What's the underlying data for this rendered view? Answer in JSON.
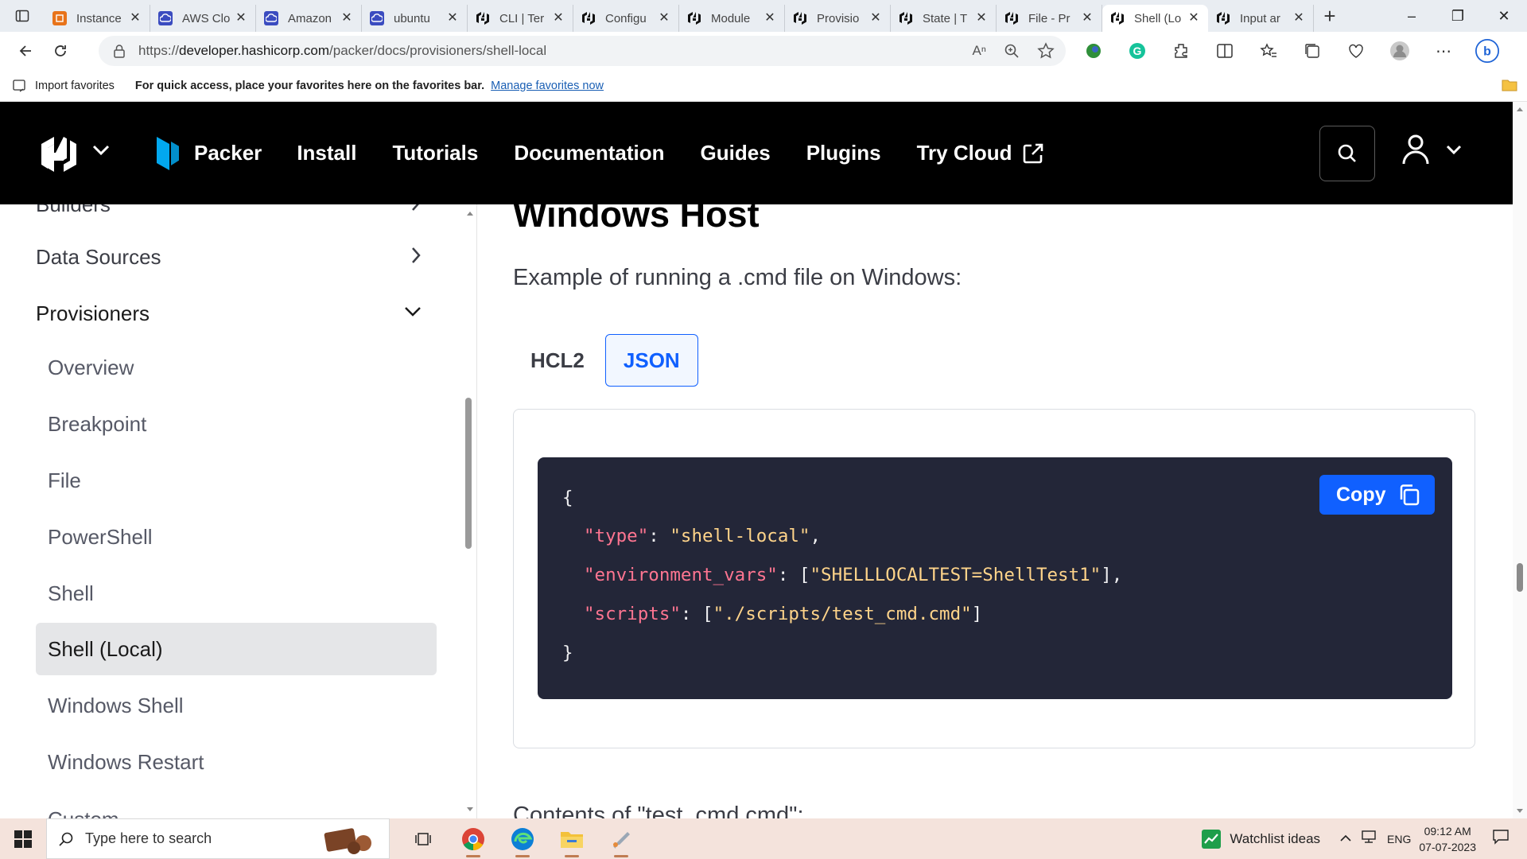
{
  "browser": {
    "tabs": [
      {
        "label": "Instance",
        "icon": "aws-orange-icon",
        "color": "#e8731a",
        "active": false
      },
      {
        "label": "AWS Clo",
        "icon": "cloud-icon",
        "color": "#3b4cc0",
        "active": false
      },
      {
        "label": "Amazon",
        "icon": "cloud-icon",
        "color": "#3b4cc0",
        "active": false
      },
      {
        "label": "ubuntu",
        "icon": "cloud-icon",
        "color": "#3b4cc0",
        "active": false
      },
      {
        "label": "CLI | Ter",
        "icon": "hashicorp-icon",
        "color": "#000000",
        "active": false
      },
      {
        "label": "Configu",
        "icon": "hashicorp-icon",
        "color": "#000000",
        "active": false
      },
      {
        "label": "Module",
        "icon": "hashicorp-icon",
        "color": "#000000",
        "active": false
      },
      {
        "label": "Provisio",
        "icon": "hashicorp-icon",
        "color": "#000000",
        "active": false
      },
      {
        "label": "State | T",
        "icon": "hashicorp-icon",
        "color": "#000000",
        "active": false
      },
      {
        "label": "File - Pr",
        "icon": "hashicorp-icon",
        "color": "#000000",
        "active": false
      },
      {
        "label": "Shell (Lo",
        "icon": "hashicorp-icon",
        "color": "#000000",
        "active": true
      },
      {
        "label": "Input ar",
        "icon": "hashicorp-icon",
        "color": "#000000",
        "active": false
      }
    ],
    "url_prefix": "https://",
    "url_host": "developer.hashicorp.com",
    "url_path": "/packer/docs/provisioners/shell-local",
    "favorites": {
      "import_label": "Import favorites",
      "message": "For quick access, place your favorites here on the favorites bar.",
      "manage_link": "Manage favorites now"
    }
  },
  "site": {
    "product": "Packer",
    "nav": [
      "Install",
      "Tutorials",
      "Documentation",
      "Guides",
      "Plugins"
    ],
    "try_cloud": "Try Cloud"
  },
  "sidebar": {
    "partial_top": "Builders",
    "data_sources": "Data Sources",
    "provisioners": "Provisioners",
    "children": [
      "Overview",
      "Breakpoint",
      "File",
      "PowerShell",
      "Shell",
      "Shell (Local)",
      "Windows Shell",
      "Windows Restart"
    ],
    "active_index": 5,
    "partial_bottom": "Custom"
  },
  "content": {
    "heading": "Windows Host",
    "lead": "Example of running a .cmd file on Windows:",
    "tabs": [
      "HCL2",
      "JSON"
    ],
    "active_tab": "JSON",
    "copy_label": "Copy",
    "code": {
      "open": "{",
      "k1": "\"type\"",
      "v1": "\"shell-local\"",
      "k2": "\"environment_vars\"",
      "v2": "\"SHELLLOCALTEST=ShellTest1\"",
      "k3": "\"scripts\"",
      "v3": "\"./scripts/test_cmd.cmd\"",
      "close": "}"
    },
    "next_heading": "Contents of \"test_cmd.cmd\":"
  },
  "taskbar": {
    "search_placeholder": "Type here to search",
    "watchlist": "Watchlist ideas",
    "lang": "ENG",
    "time": "09:12 AM",
    "date": "07-07-2023"
  }
}
